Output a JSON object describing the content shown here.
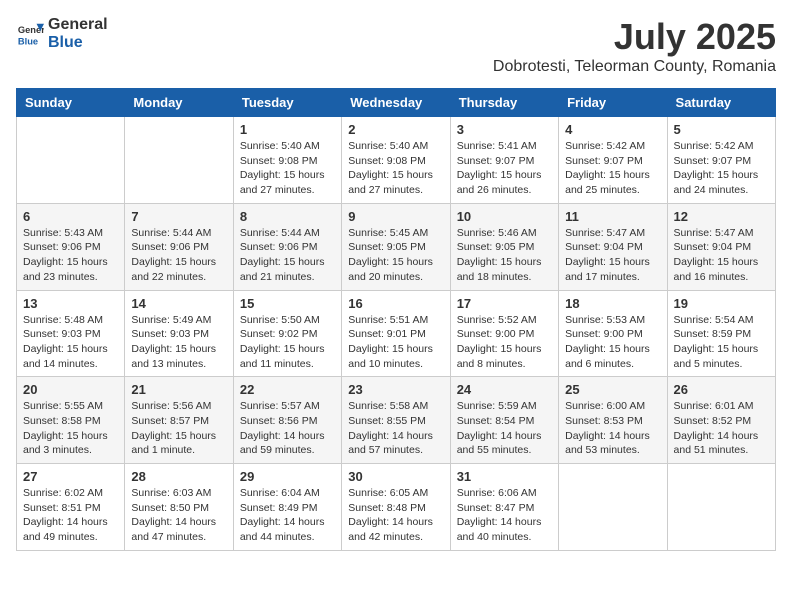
{
  "header": {
    "logo_general": "General",
    "logo_blue": "Blue",
    "month": "July 2025",
    "location": "Dobrotesti, Teleorman County, Romania"
  },
  "weekdays": [
    "Sunday",
    "Monday",
    "Tuesday",
    "Wednesday",
    "Thursday",
    "Friday",
    "Saturday"
  ],
  "weeks": [
    [
      {
        "day": "",
        "info": ""
      },
      {
        "day": "",
        "info": ""
      },
      {
        "day": "1",
        "info": "Sunrise: 5:40 AM\nSunset: 9:08 PM\nDaylight: 15 hours and 27 minutes."
      },
      {
        "day": "2",
        "info": "Sunrise: 5:40 AM\nSunset: 9:08 PM\nDaylight: 15 hours and 27 minutes."
      },
      {
        "day": "3",
        "info": "Sunrise: 5:41 AM\nSunset: 9:07 PM\nDaylight: 15 hours and 26 minutes."
      },
      {
        "day": "4",
        "info": "Sunrise: 5:42 AM\nSunset: 9:07 PM\nDaylight: 15 hours and 25 minutes."
      },
      {
        "day": "5",
        "info": "Sunrise: 5:42 AM\nSunset: 9:07 PM\nDaylight: 15 hours and 24 minutes."
      }
    ],
    [
      {
        "day": "6",
        "info": "Sunrise: 5:43 AM\nSunset: 9:06 PM\nDaylight: 15 hours and 23 minutes."
      },
      {
        "day": "7",
        "info": "Sunrise: 5:44 AM\nSunset: 9:06 PM\nDaylight: 15 hours and 22 minutes."
      },
      {
        "day": "8",
        "info": "Sunrise: 5:44 AM\nSunset: 9:06 PM\nDaylight: 15 hours and 21 minutes."
      },
      {
        "day": "9",
        "info": "Sunrise: 5:45 AM\nSunset: 9:05 PM\nDaylight: 15 hours and 20 minutes."
      },
      {
        "day": "10",
        "info": "Sunrise: 5:46 AM\nSunset: 9:05 PM\nDaylight: 15 hours and 18 minutes."
      },
      {
        "day": "11",
        "info": "Sunrise: 5:47 AM\nSunset: 9:04 PM\nDaylight: 15 hours and 17 minutes."
      },
      {
        "day": "12",
        "info": "Sunrise: 5:47 AM\nSunset: 9:04 PM\nDaylight: 15 hours and 16 minutes."
      }
    ],
    [
      {
        "day": "13",
        "info": "Sunrise: 5:48 AM\nSunset: 9:03 PM\nDaylight: 15 hours and 14 minutes."
      },
      {
        "day": "14",
        "info": "Sunrise: 5:49 AM\nSunset: 9:03 PM\nDaylight: 15 hours and 13 minutes."
      },
      {
        "day": "15",
        "info": "Sunrise: 5:50 AM\nSunset: 9:02 PM\nDaylight: 15 hours and 11 minutes."
      },
      {
        "day": "16",
        "info": "Sunrise: 5:51 AM\nSunset: 9:01 PM\nDaylight: 15 hours and 10 minutes."
      },
      {
        "day": "17",
        "info": "Sunrise: 5:52 AM\nSunset: 9:00 PM\nDaylight: 15 hours and 8 minutes."
      },
      {
        "day": "18",
        "info": "Sunrise: 5:53 AM\nSunset: 9:00 PM\nDaylight: 15 hours and 6 minutes."
      },
      {
        "day": "19",
        "info": "Sunrise: 5:54 AM\nSunset: 8:59 PM\nDaylight: 15 hours and 5 minutes."
      }
    ],
    [
      {
        "day": "20",
        "info": "Sunrise: 5:55 AM\nSunset: 8:58 PM\nDaylight: 15 hours and 3 minutes."
      },
      {
        "day": "21",
        "info": "Sunrise: 5:56 AM\nSunset: 8:57 PM\nDaylight: 15 hours and 1 minute."
      },
      {
        "day": "22",
        "info": "Sunrise: 5:57 AM\nSunset: 8:56 PM\nDaylight: 14 hours and 59 minutes."
      },
      {
        "day": "23",
        "info": "Sunrise: 5:58 AM\nSunset: 8:55 PM\nDaylight: 14 hours and 57 minutes."
      },
      {
        "day": "24",
        "info": "Sunrise: 5:59 AM\nSunset: 8:54 PM\nDaylight: 14 hours and 55 minutes."
      },
      {
        "day": "25",
        "info": "Sunrise: 6:00 AM\nSunset: 8:53 PM\nDaylight: 14 hours and 53 minutes."
      },
      {
        "day": "26",
        "info": "Sunrise: 6:01 AM\nSunset: 8:52 PM\nDaylight: 14 hours and 51 minutes."
      }
    ],
    [
      {
        "day": "27",
        "info": "Sunrise: 6:02 AM\nSunset: 8:51 PM\nDaylight: 14 hours and 49 minutes."
      },
      {
        "day": "28",
        "info": "Sunrise: 6:03 AM\nSunset: 8:50 PM\nDaylight: 14 hours and 47 minutes."
      },
      {
        "day": "29",
        "info": "Sunrise: 6:04 AM\nSunset: 8:49 PM\nDaylight: 14 hours and 44 minutes."
      },
      {
        "day": "30",
        "info": "Sunrise: 6:05 AM\nSunset: 8:48 PM\nDaylight: 14 hours and 42 minutes."
      },
      {
        "day": "31",
        "info": "Sunrise: 6:06 AM\nSunset: 8:47 PM\nDaylight: 14 hours and 40 minutes."
      },
      {
        "day": "",
        "info": ""
      },
      {
        "day": "",
        "info": ""
      }
    ]
  ]
}
